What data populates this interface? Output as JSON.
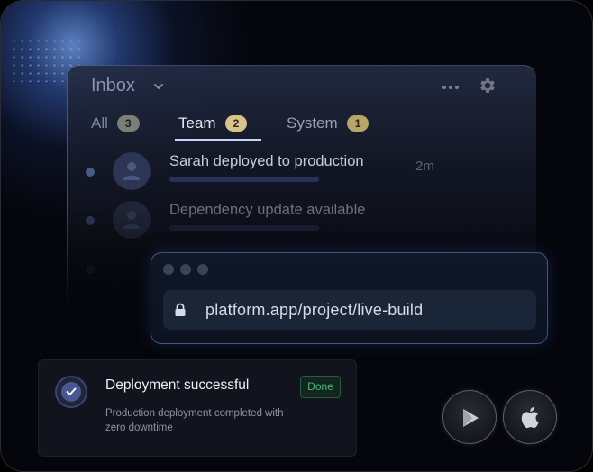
{
  "inbox": {
    "title": "Inbox",
    "tabs": [
      {
        "label": "All",
        "count": "3"
      },
      {
        "label": "Team",
        "count": "2"
      },
      {
        "label": "System",
        "count": "1"
      }
    ],
    "items": [
      {
        "title": "Sarah deployed to production",
        "time": "2m"
      },
      {
        "title": "Dependency update available",
        "time": ""
      }
    ]
  },
  "browser": {
    "url": "platform.app/project/live-build"
  },
  "toast": {
    "title": "Deployment successful",
    "body": "Production deployment completed with zero downtime",
    "action_label": "Done"
  },
  "icons": {
    "inbox_dropdown": "chevron-down-icon",
    "more": "more-horizontal-icon",
    "settings": "gear-icon",
    "url_lock": "lock-icon",
    "toast_status": "check-circle-icon",
    "store_left": "google-play-icon",
    "store_right": "apple-icon"
  },
  "colors": {
    "accent": "#c8d4ff",
    "success": "#4bb884",
    "badge_team": "#d7c48a"
  }
}
